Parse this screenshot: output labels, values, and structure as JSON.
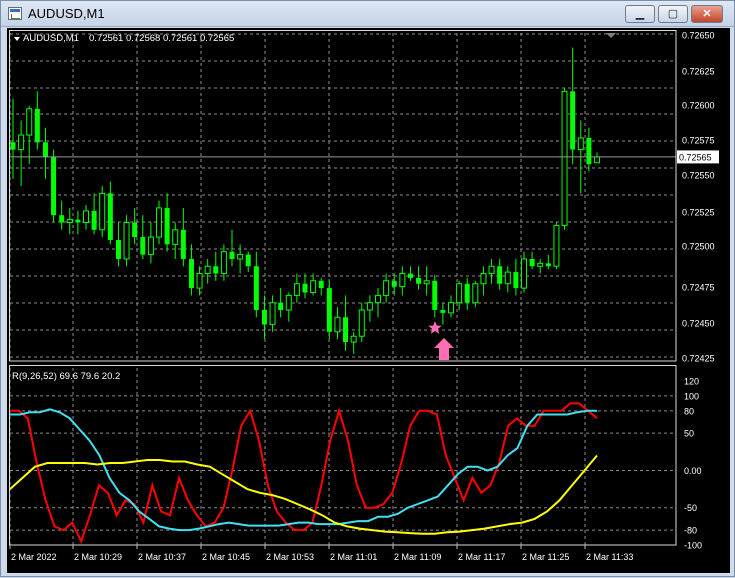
{
  "window": {
    "title": "AUDUSD,M1",
    "minimize_label": "▁",
    "maximize_label": "▢",
    "close_label": "✕"
  },
  "main_chart": {
    "symbol_label": "AUDUSD,M1",
    "ohlc_text": "0.72561 0.72568 0.72561 0.72565",
    "current_price": "0.72565",
    "price_labels": [
      "0.72650",
      "0.72625",
      "0.72600",
      "0.72575",
      "0.72550",
      "0.72525",
      "0.72500",
      "0.72475",
      "0.72450",
      "0.72425"
    ]
  },
  "indicator": {
    "label": "R(9,26,52) 69.6 79.6 20.2",
    "scale_labels": [
      "120",
      "100",
      "80",
      "50",
      "0.00",
      "-50",
      "-80",
      "-100"
    ]
  },
  "time_axis": {
    "labels": [
      "2 Mar 2022",
      "2 Mar 10:29",
      "2 Mar 10:37",
      "2 Mar 10:45",
      "2 Mar 10:53",
      "2 Mar 11:01",
      "2 Mar 11:09",
      "2 Mar 11:17",
      "2 Mar 11:25",
      "2 Mar 11:33"
    ]
  },
  "colors": {
    "background": "#000000",
    "grid": "#8c8c8c",
    "candle": "#00ff00",
    "line_red": "#ff0000",
    "line_cyan": "#40e0f0",
    "line_yellow": "#ffff00",
    "marker": "#ff6eb4"
  },
  "chart_data": [
    {
      "type": "candlestick",
      "title": "AUDUSD,M1",
      "ylim": [
        0.72425,
        0.7265
      ],
      "x": [
        "2 Mar 2022",
        "2 Mar 10:29",
        "2 Mar 10:37",
        "2 Mar 10:45",
        "2 Mar 10:53",
        "2 Mar 11:01",
        "2 Mar 11:09",
        "2 Mar 11:17",
        "2 Mar 11:25",
        "2 Mar 11:33"
      ],
      "ohlc": [
        [
          0.72575,
          0.72605,
          0.7255,
          0.7257
        ],
        [
          0.7257,
          0.7259,
          0.72545,
          0.7258
        ],
        [
          0.7258,
          0.726,
          0.7256,
          0.72598
        ],
        [
          0.72598,
          0.7261,
          0.7257,
          0.72575
        ],
        [
          0.72575,
          0.72585,
          0.7255,
          0.72565
        ],
        [
          0.72565,
          0.7257,
          0.7252,
          0.72525
        ],
        [
          0.72525,
          0.72535,
          0.72515,
          0.7252
        ],
        [
          0.7252,
          0.7253,
          0.72512,
          0.72522
        ],
        [
          0.72522,
          0.72528,
          0.72512,
          0.7252
        ],
        [
          0.7252,
          0.72532,
          0.72515,
          0.72528
        ],
        [
          0.72528,
          0.7254,
          0.72512,
          0.72515
        ],
        [
          0.72515,
          0.72545,
          0.7251,
          0.7254
        ],
        [
          0.7254,
          0.72548,
          0.72505,
          0.72508
        ],
        [
          0.72508,
          0.7252,
          0.7249,
          0.72495
        ],
        [
          0.72495,
          0.72525,
          0.7249,
          0.7252
        ],
        [
          0.7252,
          0.7253,
          0.72505,
          0.7251
        ],
        [
          0.7251,
          0.72525,
          0.72495,
          0.72498
        ],
        [
          0.72498,
          0.7252,
          0.72492,
          0.7251
        ],
        [
          0.7251,
          0.72535,
          0.72505,
          0.7253
        ],
        [
          0.7253,
          0.7254,
          0.725,
          0.72505
        ],
        [
          0.72505,
          0.7252,
          0.72495,
          0.72515
        ],
        [
          0.72515,
          0.7253,
          0.7249,
          0.72495
        ],
        [
          0.72495,
          0.72505,
          0.7247,
          0.72475
        ],
        [
          0.72475,
          0.7249,
          0.7247,
          0.72485
        ],
        [
          0.72485,
          0.72495,
          0.72478,
          0.7249
        ],
        [
          0.7249,
          0.725,
          0.7248,
          0.72485
        ],
        [
          0.72485,
          0.72505,
          0.7248,
          0.725
        ],
        [
          0.725,
          0.72515,
          0.7249,
          0.72495
        ],
        [
          0.72495,
          0.72505,
          0.72485,
          0.72498
        ],
        [
          0.72498,
          0.725,
          0.72486,
          0.7249
        ],
        [
          0.7249,
          0.725,
          0.72455,
          0.7246
        ],
        [
          0.7246,
          0.7247,
          0.7244,
          0.7245
        ],
        [
          0.7245,
          0.7247,
          0.72445,
          0.72465
        ],
        [
          0.72465,
          0.72475,
          0.72455,
          0.7246
        ],
        [
          0.7246,
          0.72472,
          0.72452,
          0.7247
        ],
        [
          0.7247,
          0.72485,
          0.72465,
          0.72478
        ],
        [
          0.72478,
          0.72485,
          0.72468,
          0.72472
        ],
        [
          0.72472,
          0.72485,
          0.7247,
          0.7248
        ],
        [
          0.7248,
          0.72482,
          0.7247,
          0.72475
        ],
        [
          0.72475,
          0.7248,
          0.7244,
          0.72445
        ],
        [
          0.72445,
          0.72462,
          0.7244,
          0.72455
        ],
        [
          0.72455,
          0.7247,
          0.72432,
          0.72438
        ],
        [
          0.72438,
          0.72445,
          0.7243,
          0.72442
        ],
        [
          0.72442,
          0.72465,
          0.72438,
          0.7246
        ],
        [
          0.7246,
          0.7247,
          0.72452,
          0.72465
        ],
        [
          0.72465,
          0.72475,
          0.72455,
          0.7247
        ],
        [
          0.7247,
          0.72485,
          0.72465,
          0.7248
        ],
        [
          0.7248,
          0.72485,
          0.7247,
          0.72476
        ],
        [
          0.72476,
          0.7249,
          0.7247,
          0.72485
        ],
        [
          0.72485,
          0.7249,
          0.7248,
          0.72482
        ],
        [
          0.72482,
          0.7249,
          0.72474,
          0.72478
        ],
        [
          0.72478,
          0.7249,
          0.7247,
          0.7248
        ],
        [
          0.7248,
          0.72484,
          0.72455,
          0.7246
        ],
        [
          0.7246,
          0.72465,
          0.7245,
          0.72458
        ],
        [
          0.72458,
          0.7247,
          0.72455,
          0.72465
        ],
        [
          0.72465,
          0.7248,
          0.7246,
          0.72478
        ],
        [
          0.72478,
          0.72482,
          0.7246,
          0.72465
        ],
        [
          0.72465,
          0.7248,
          0.72462,
          0.72478
        ],
        [
          0.72478,
          0.7249,
          0.7247,
          0.72485
        ],
        [
          0.72485,
          0.72495,
          0.72478,
          0.7249
        ],
        [
          0.7249,
          0.72495,
          0.72474,
          0.72478
        ],
        [
          0.72478,
          0.7249,
          0.72472,
          0.72486
        ],
        [
          0.72486,
          0.72495,
          0.7247,
          0.72475
        ],
        [
          0.72475,
          0.725,
          0.72472,
          0.72495
        ],
        [
          0.72495,
          0.725,
          0.72488,
          0.7249
        ],
        [
          0.7249,
          0.72495,
          0.72485,
          0.72492
        ],
        [
          0.72492,
          0.72498,
          0.72488,
          0.7249
        ],
        [
          0.7249,
          0.7252,
          0.72488,
          0.72518
        ],
        [
          0.72518,
          0.72612,
          0.72515,
          0.7261
        ],
        [
          0.7261,
          0.7264,
          0.7256,
          0.7257
        ],
        [
          0.7257,
          0.7259,
          0.7254,
          0.72578
        ],
        [
          0.72578,
          0.72585,
          0.72555,
          0.7256
        ],
        [
          0.72561,
          0.72568,
          0.72561,
          0.72565
        ]
      ]
    },
    {
      "type": "line",
      "title": "R(9,26,52) 69.6 79.6 20.2",
      "ylim": [
        -100,
        120
      ],
      "series": [
        {
          "name": "R(9)",
          "values": [
            80,
            80,
            70,
            10,
            -40,
            -75,
            -80,
            -70,
            -95,
            -60,
            -20,
            -30,
            -60,
            -40,
            -45,
            -70,
            -20,
            -55,
            -60,
            -10,
            -40,
            -60,
            -75,
            -70,
            -50,
            0,
            60,
            80,
            40,
            -20,
            -55,
            -70,
            -80,
            -80,
            -70,
            -20,
            40,
            80,
            40,
            -20,
            -50,
            -50,
            -45,
            -30,
            10,
            60,
            80,
            80,
            75,
            20,
            -10,
            -40,
            -10,
            -30,
            -20,
            10,
            60,
            70,
            60,
            60,
            80,
            80,
            80,
            90,
            90,
            80,
            70
          ]
        },
        {
          "name": "R(26)",
          "values": [
            75,
            75,
            78,
            78,
            82,
            78,
            70,
            55,
            40,
            20,
            -10,
            -30,
            -40,
            -55,
            -65,
            -75,
            -78,
            -80,
            -80,
            -78,
            -75,
            -72,
            -70,
            -72,
            -74,
            -74,
            -74,
            -74,
            -72,
            -70,
            -70,
            -72,
            -72,
            -72,
            -70,
            -68,
            -68,
            -62,
            -62,
            -58,
            -50,
            -45,
            -40,
            -35,
            -20,
            -5,
            5,
            5,
            0,
            5,
            20,
            30,
            60,
            75,
            75,
            75,
            75,
            78,
            80,
            80
          ]
        },
        {
          "name": "R(52)",
          "values": [
            -25,
            -10,
            5,
            10,
            10,
            10,
            10,
            8,
            10,
            10,
            12,
            14,
            14,
            12,
            12,
            8,
            5,
            -5,
            -15,
            -25,
            -30,
            -33,
            -38,
            -45,
            -52,
            -60,
            -70,
            -75,
            -78,
            -80,
            -82,
            -83,
            -84,
            -85,
            -85,
            -83,
            -82,
            -80,
            -78,
            -75,
            -72,
            -70,
            -65,
            -55,
            -40,
            -20,
            0,
            20
          ]
        }
      ]
    }
  ]
}
